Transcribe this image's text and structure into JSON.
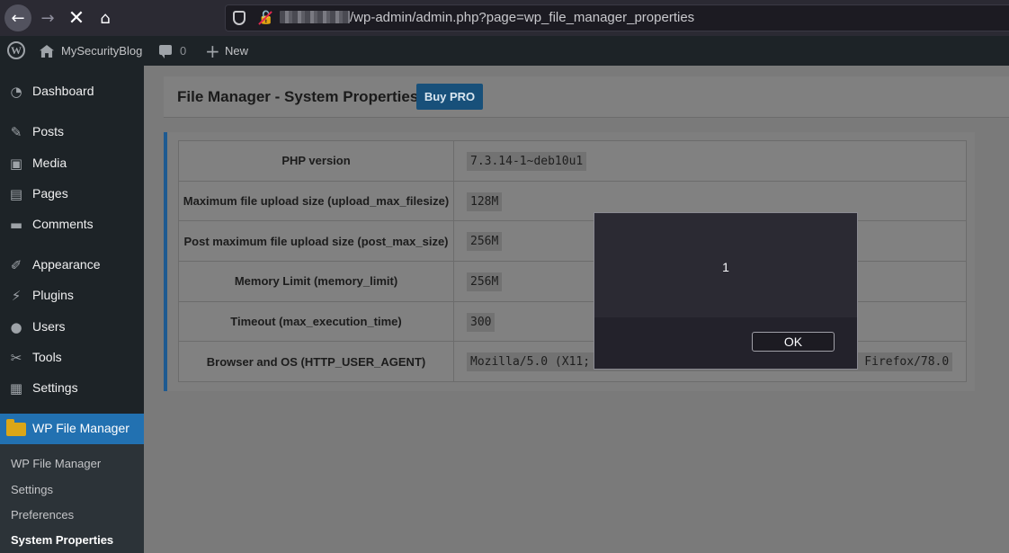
{
  "browser": {
    "url_path": "/wp-admin/admin.php?page=wp_file_manager_properties",
    "icons": {
      "back": "arrow-left-icon",
      "forward": "arrow-right-icon",
      "stop": "close-icon",
      "home": "home-icon"
    },
    "back_glyph": "←",
    "forward_glyph": "→",
    "stop_glyph": "✕",
    "home_glyph": "⌂"
  },
  "admin_bar": {
    "logo_glyph": "W",
    "site_name": "MySecurityBlog",
    "comment_count": "0",
    "new_glyph": "+",
    "new_label": "New"
  },
  "sidebar": {
    "items": [
      {
        "label": "Dashboard",
        "icon": "dashboard-icon",
        "glyph": "◔"
      },
      {
        "label": "Posts",
        "icon": "pin-icon",
        "glyph": "✎"
      },
      {
        "label": "Media",
        "icon": "media-icon",
        "glyph": "▣"
      },
      {
        "label": "Pages",
        "icon": "pages-icon",
        "glyph": "▤"
      },
      {
        "label": "Comments",
        "icon": "comment-icon",
        "glyph": "▬"
      },
      {
        "label": "Appearance",
        "icon": "brush-icon",
        "glyph": "✐"
      },
      {
        "label": "Plugins",
        "icon": "plugin-icon",
        "glyph": "⚡"
      },
      {
        "label": "Users",
        "icon": "user-icon",
        "glyph": "●"
      },
      {
        "label": "Tools",
        "icon": "wrench-icon",
        "glyph": "✂"
      },
      {
        "label": "Settings",
        "icon": "settings-icon",
        "glyph": "▦"
      }
    ],
    "active_item": {
      "label": "WP File Manager",
      "icon": "folder-icon"
    },
    "submenu": [
      "WP File Manager",
      "Settings",
      "Preferences",
      "System Properties"
    ]
  },
  "header": {
    "title": "File Manager - System Properties",
    "buy_pro_label": "Buy PRO"
  },
  "properties": [
    {
      "label": "PHP version",
      "value": "7.3.14-1~deb10u1"
    },
    {
      "label": "Maximum file upload size (upload_max_filesize)",
      "value": "128M"
    },
    {
      "label": "Post maximum file upload size (post_max_size)",
      "value": "256M"
    },
    {
      "label": "Memory Limit (memory_limit)",
      "value": "256M"
    },
    {
      "label": "Timeout (max_execution_time)",
      "value": "300"
    },
    {
      "label": "Browser and OS (HTTP_USER_AGENT)",
      "value": "Mozilla/5.0 (X11; Linux x86_64; rv:78.0) Gecko/20100101 Firefox/78.0"
    }
  ],
  "dialog": {
    "message": "1",
    "ok_label": "OK"
  },
  "colors": {
    "admin_dark": "#1d2327",
    "wp_blue": "#2271b1",
    "folder_yellow": "#dba617",
    "dialog_bg": "#2b2a33"
  }
}
